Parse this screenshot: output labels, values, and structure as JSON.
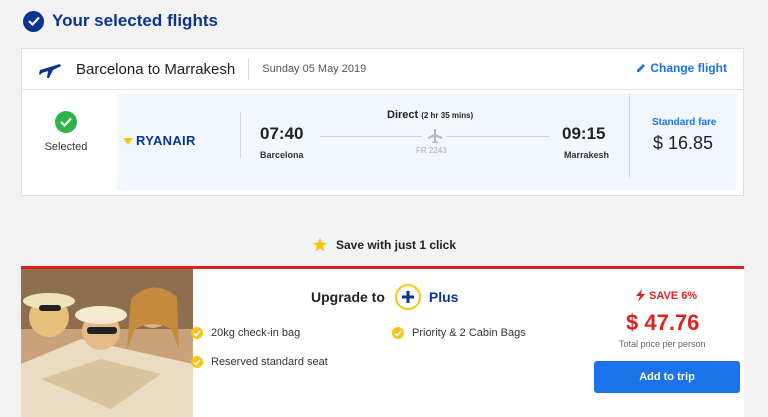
{
  "page": {
    "title": "Your selected flights"
  },
  "flight": {
    "route": "Barcelona to Marrakesh",
    "date": "Sunday 05 May 2019",
    "change_label": "Change flight",
    "selected_label": "Selected",
    "airline": "RYANAIR",
    "departure": {
      "time": "07:40",
      "city": "Barcelona"
    },
    "arrival": {
      "time": "09:15",
      "city": "Marrakesh"
    },
    "type": "Direct",
    "duration": "(2 hr 35 mins)",
    "flight_number": "FR 2243",
    "fare_name": "Standard fare",
    "fare_price": "$ 16.85"
  },
  "promo": {
    "save_text": "Save with just 1 click"
  },
  "upgrade": {
    "prefix": "Upgrade to",
    "plan": "Plus",
    "features": [
      "20kg check-in bag",
      "Priority & 2 Cabin Bags",
      "Reserved standard seat"
    ],
    "save_badge": "SAVE 6%",
    "price": "$ 47.76",
    "price_note": "Total price per person",
    "button_label": "Add to trip"
  },
  "colors": {
    "brand": "#073590",
    "accent": "#1a73e8",
    "success": "#2eb24a",
    "alert": "#e02020",
    "highlight": "#f5c518"
  },
  "icons": [
    "check-circle-icon",
    "airplane-icon",
    "pencil-icon",
    "green-check-icon",
    "ryanair-harp-icon",
    "star-icon",
    "plus-icon",
    "tick-icon",
    "lightning-icon"
  ]
}
